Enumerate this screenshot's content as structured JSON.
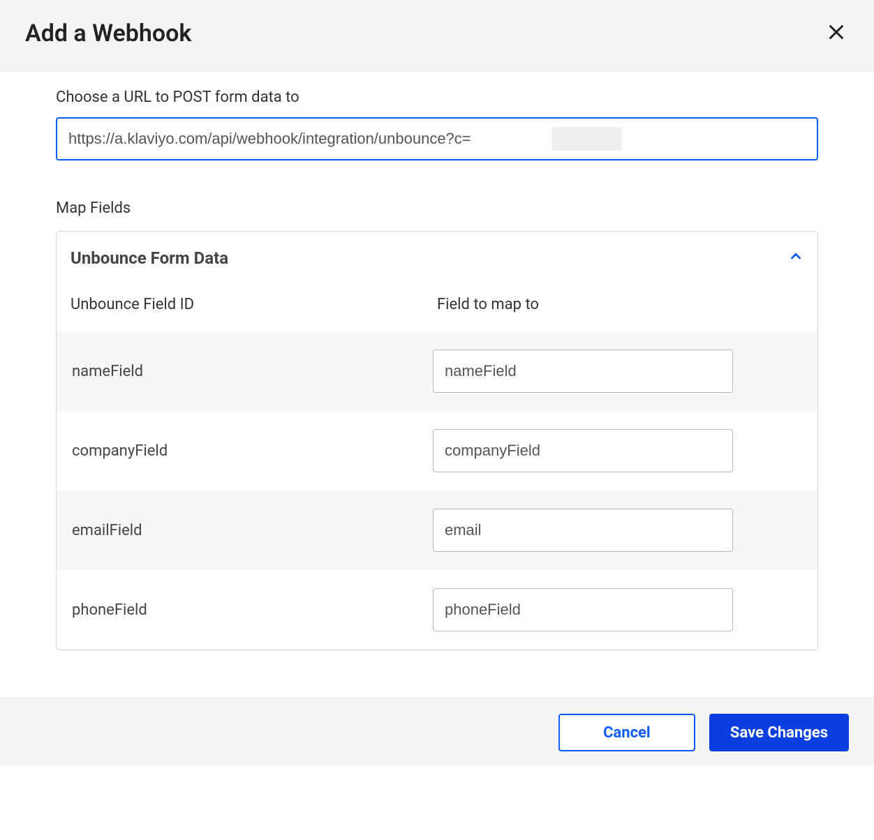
{
  "header": {
    "title": "Add a Webhook"
  },
  "urlSection": {
    "label": "Choose a URL to POST form data to",
    "value": "https://a.klaviyo.com/api/webhook/integration/unbounce?c="
  },
  "mapFields": {
    "label": "Map Fields",
    "panelTitle": "Unbounce Form Data",
    "col1": "Unbounce Field ID",
    "col2": "Field to map to",
    "rows": [
      {
        "id": "nameField",
        "mapTo": "nameField"
      },
      {
        "id": "companyField",
        "mapTo": "companyField"
      },
      {
        "id": "emailField",
        "mapTo": "email"
      },
      {
        "id": "phoneField",
        "mapTo": "phoneField"
      }
    ]
  },
  "footer": {
    "cancel": "Cancel",
    "save": "Save Changes"
  },
  "colors": {
    "accent": "#0b5cff",
    "primaryBtn": "#0b3fe0"
  }
}
